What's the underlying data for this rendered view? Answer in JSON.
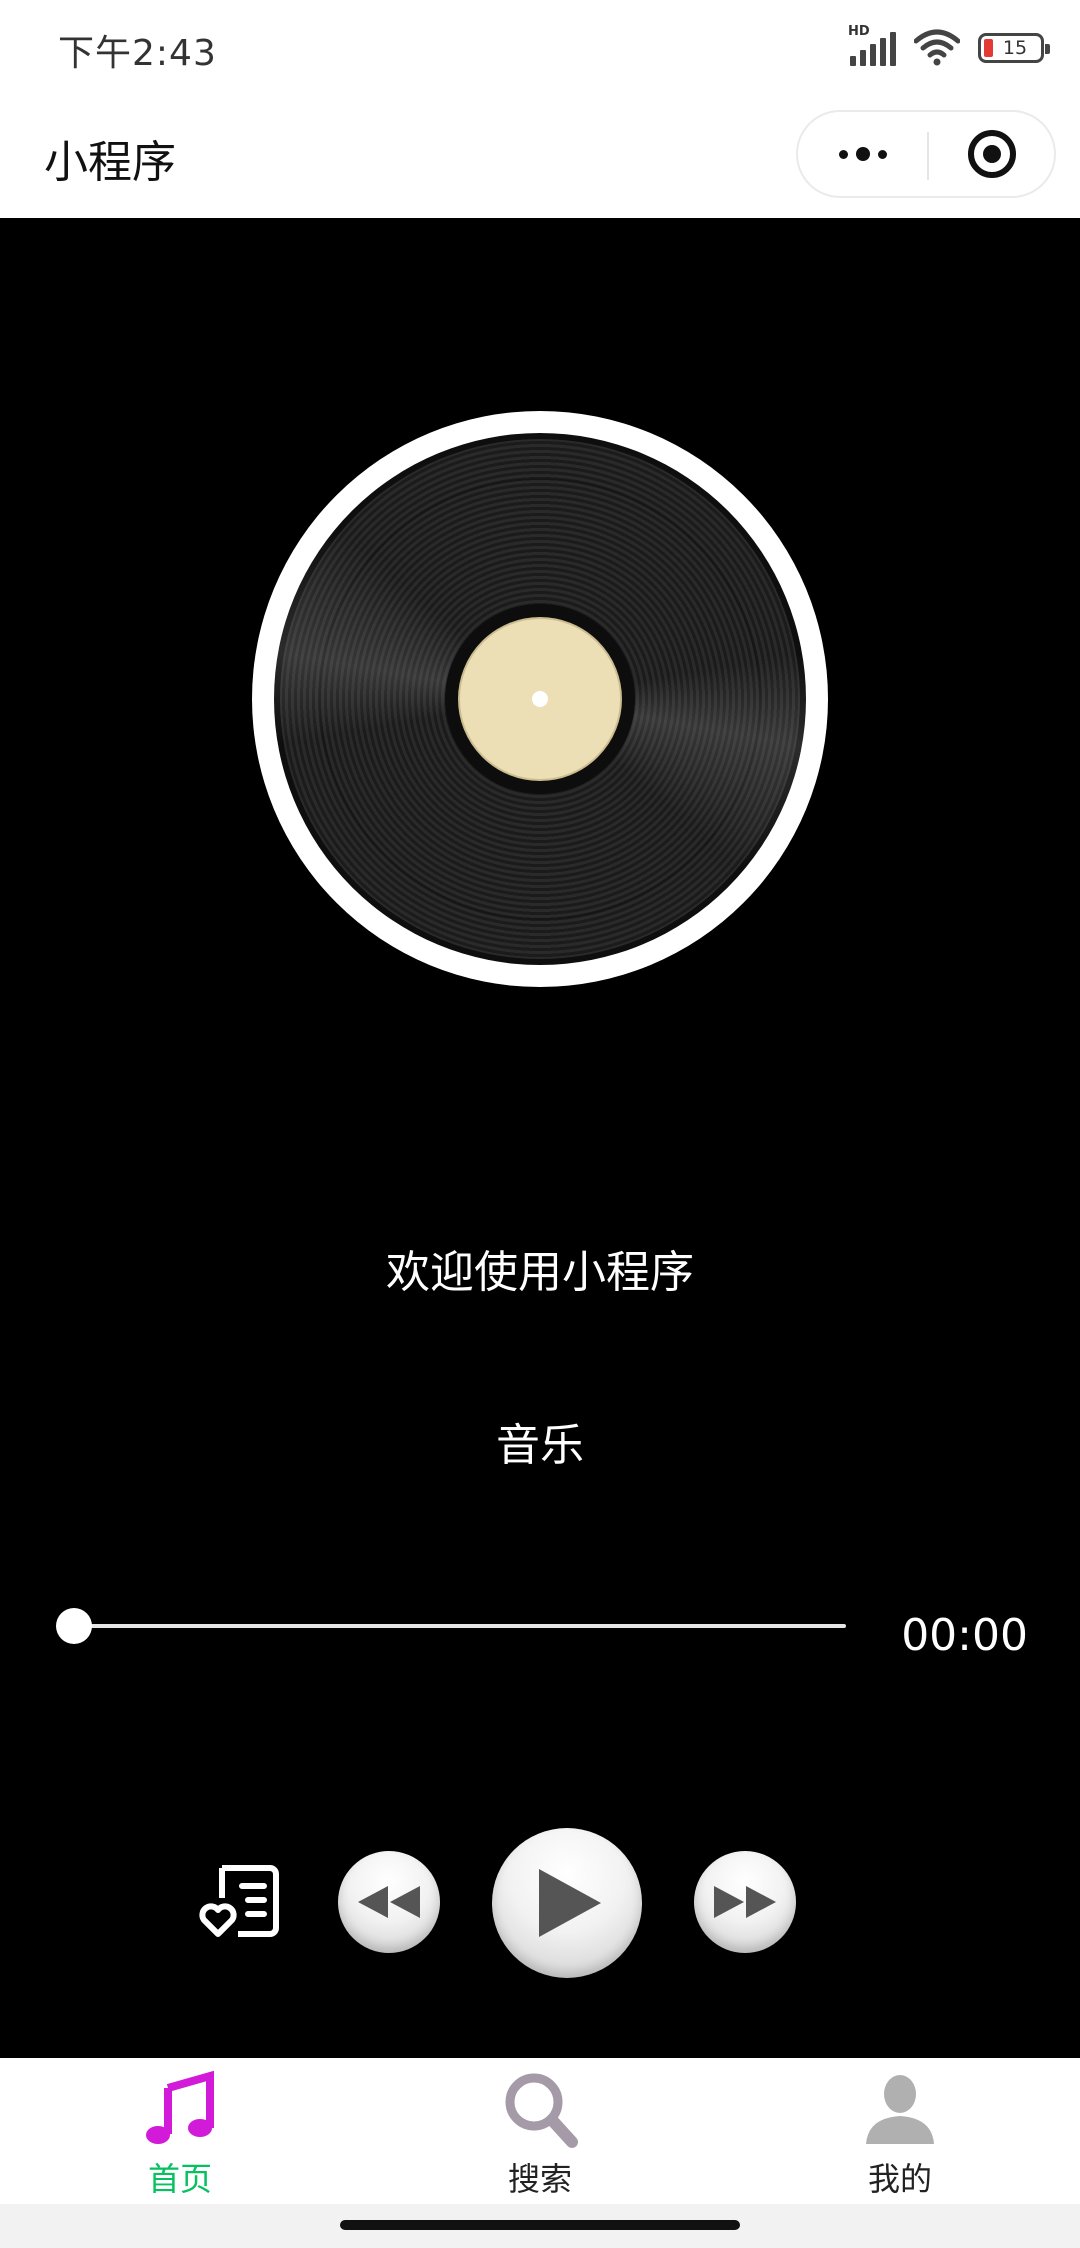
{
  "status_bar": {
    "time": "下午2:43",
    "signal_label": "HD",
    "battery_level": "15",
    "battery_color": "#e53935"
  },
  "nav": {
    "title": "小程序",
    "more_icon": "more-dots-icon",
    "close_icon": "target-close-icon"
  },
  "player": {
    "welcome_text": "欢迎使用小程序",
    "song_name": "音乐",
    "current_time": "00:00",
    "progress": 0,
    "controls": [
      "playlist-heart-icon",
      "rewind-icon",
      "play-icon",
      "fast-forward-icon"
    ]
  },
  "tabs": [
    {
      "label": "首页",
      "icon": "music-note-icon",
      "active": true,
      "icon_color": "#d21bd8"
    },
    {
      "label": "搜索",
      "icon": "search-icon",
      "active": false,
      "icon_color": "#a49aa8"
    },
    {
      "label": "我的",
      "icon": "user-icon",
      "active": false,
      "icon_color": "#b0b0b0"
    }
  ],
  "colors": {
    "active_tab_text": "#07c160",
    "background": "#000000"
  }
}
